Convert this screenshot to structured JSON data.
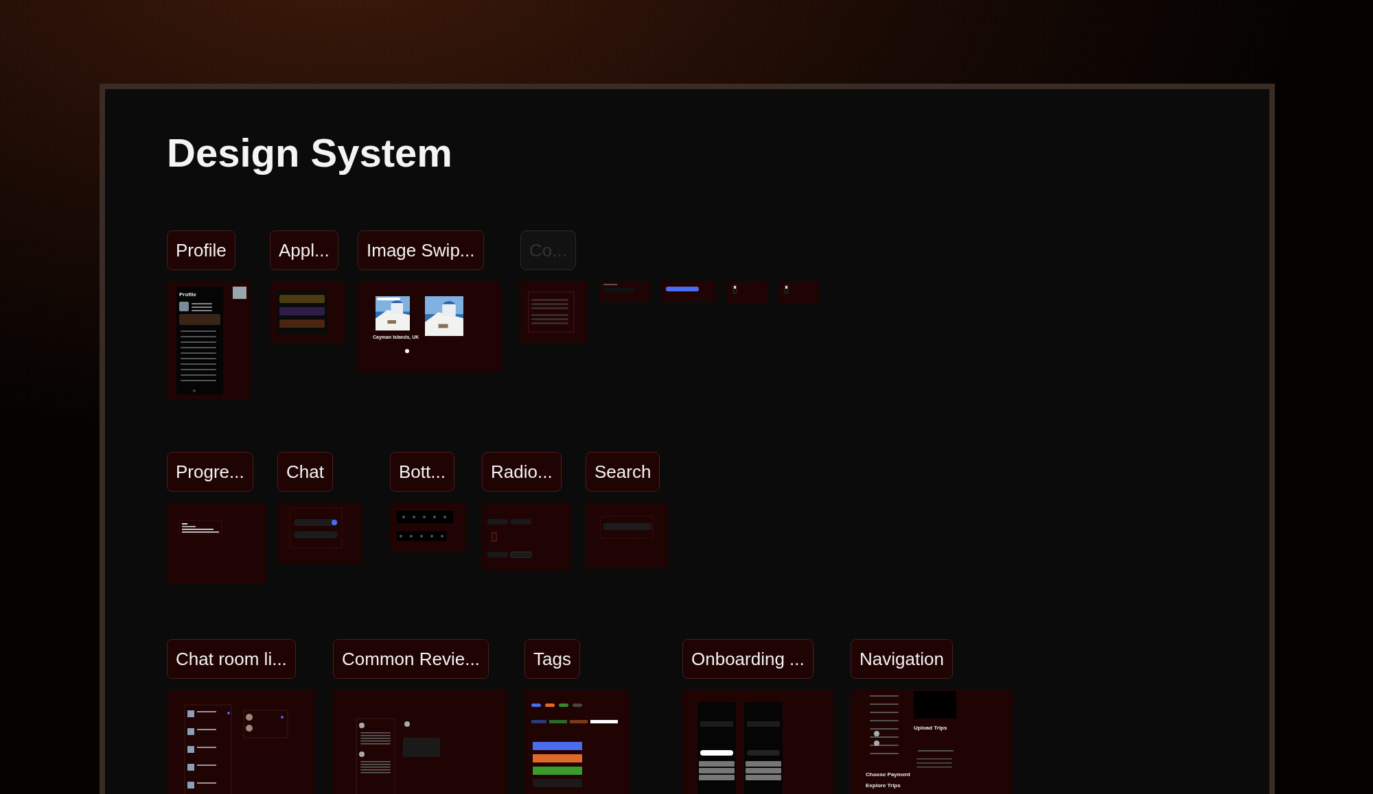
{
  "title": "Design System",
  "rows": [
    {
      "sections": [
        {
          "label": "Profile",
          "dimmed": false,
          "thumb": {
            "kind": "profile",
            "texts": [
              "Profile"
            ]
          }
        },
        {
          "label": "Appl...",
          "dimmed": false,
          "thumb": {
            "kind": "list"
          }
        },
        {
          "label": "Image Swip...",
          "dimmed": false,
          "thumb": {
            "kind": "swiper",
            "texts": [
              "Cayman Islands, UK"
            ]
          }
        },
        {
          "label": "Co...",
          "dimmed": true,
          "thumb": {
            "kind": "chips"
          }
        }
      ],
      "extra_frames": [
        {
          "kind": "dropdown"
        },
        {
          "kind": "bubble"
        },
        {
          "kind": "toggle"
        },
        {
          "kind": "toggle"
        }
      ]
    },
    {
      "sections": [
        {
          "label": "Progre...",
          "dimmed": false,
          "thumb": {
            "kind": "progress"
          }
        },
        {
          "label": "Chat",
          "dimmed": false,
          "thumb": {
            "kind": "chat"
          }
        },
        {
          "label": "Bott...",
          "dimmed": false,
          "thumb": {
            "kind": "bottomnav"
          }
        },
        {
          "label": "Radio...",
          "dimmed": false,
          "thumb": {
            "kind": "radio"
          }
        },
        {
          "label": "Search",
          "dimmed": false,
          "thumb": {
            "kind": "search"
          }
        }
      ]
    },
    {
      "sections": [
        {
          "label": "Chat room li...",
          "dimmed": false,
          "thumb": {
            "kind": "chatrooms"
          }
        },
        {
          "label": "Common Revie...",
          "dimmed": false,
          "thumb": {
            "kind": "reviews"
          }
        },
        {
          "label": "Tags",
          "dimmed": false,
          "thumb": {
            "kind": "tags"
          }
        },
        {
          "label": "Onboarding ...",
          "dimmed": false,
          "thumb": {
            "kind": "onboarding"
          }
        },
        {
          "label": "Navigation",
          "dimmed": false,
          "thumb": {
            "kind": "navigation",
            "texts": [
              "Upload Trips",
              "Choose Payment",
              "Explore Trips"
            ]
          }
        }
      ]
    }
  ]
}
